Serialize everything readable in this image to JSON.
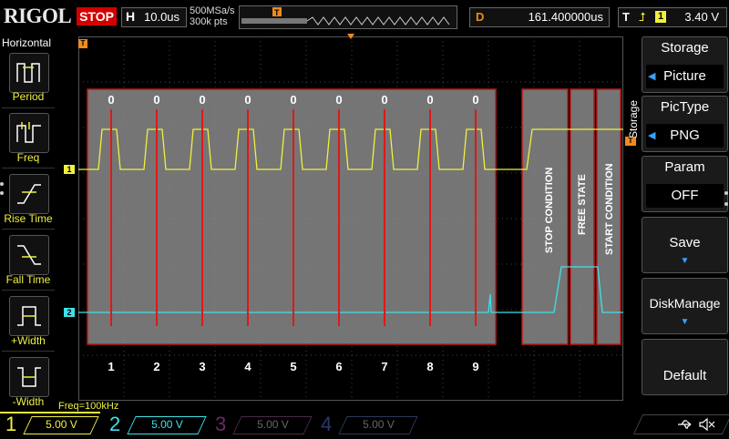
{
  "top": {
    "brand": "RIGOL",
    "run_state": "STOP",
    "timebase_label": "H",
    "timebase_value": "10.0us",
    "sample_rate": "500MSa/s",
    "memory_depth": "300k pts",
    "trigger_pos_marker": "T",
    "delay_label": "D",
    "delay_value": "161.400000us",
    "trigger_label": "T",
    "trigger_edge": "rising-edge-icon",
    "trigger_source": "1",
    "trigger_level": "3.40 V"
  },
  "horizontal_menu": {
    "title": "Horizontal",
    "items": [
      {
        "label": "Period",
        "icon": "period-icon"
      },
      {
        "label": "Freq",
        "icon": "freq-icon"
      },
      {
        "label": "Rise Time",
        "icon": "rise-time-icon"
      },
      {
        "label": "Fall Time",
        "icon": "fall-time-icon"
      },
      {
        "label": "+Width",
        "icon": "positive-width-icon"
      },
      {
        "label": "-Width",
        "icon": "negative-width-icon"
      }
    ]
  },
  "storage_menu": {
    "tab_label": "Storage",
    "items": [
      {
        "title": "Storage",
        "value": "Picture"
      },
      {
        "title": "PicType",
        "value": "PNG"
      },
      {
        "title": "Param",
        "value": "OFF"
      },
      {
        "title": "Save"
      },
      {
        "title": "DiskManage"
      },
      {
        "title": "Default"
      }
    ]
  },
  "waveform": {
    "ch1_marker": "1",
    "ch2_marker": "2",
    "trigger_marker": "T",
    "bit_values": [
      "0",
      "0",
      "0",
      "0",
      "0",
      "0",
      "0",
      "0",
      "0"
    ],
    "bit_numbers": [
      "1",
      "2",
      "3",
      "4",
      "5",
      "6",
      "7",
      "8",
      "9"
    ],
    "annotations": [
      "STOP CONDITION",
      "FREE STATE",
      "START CONDITION"
    ],
    "colors": {
      "ch1": "#f0f040",
      "ch2": "#40e0e8",
      "highlight": "#7a7a7a",
      "red": "#e01818",
      "trigger": "#f08a1c"
    }
  },
  "measure": {
    "freq": "Freq=100kHz"
  },
  "channels": [
    {
      "num": "1",
      "scale": "5.00 V",
      "color": "#f0f040",
      "active": true
    },
    {
      "num": "2",
      "scale": "5.00 V",
      "color": "#40e0e8",
      "active": true
    },
    {
      "num": "3",
      "scale": "5.00 V",
      "color": "#c040c0",
      "active": false
    },
    {
      "num": "4",
      "scale": "5.00 V",
      "color": "#4060d0",
      "active": false
    }
  ],
  "status_icons": [
    "usb-icon",
    "speaker-muted-icon"
  ]
}
